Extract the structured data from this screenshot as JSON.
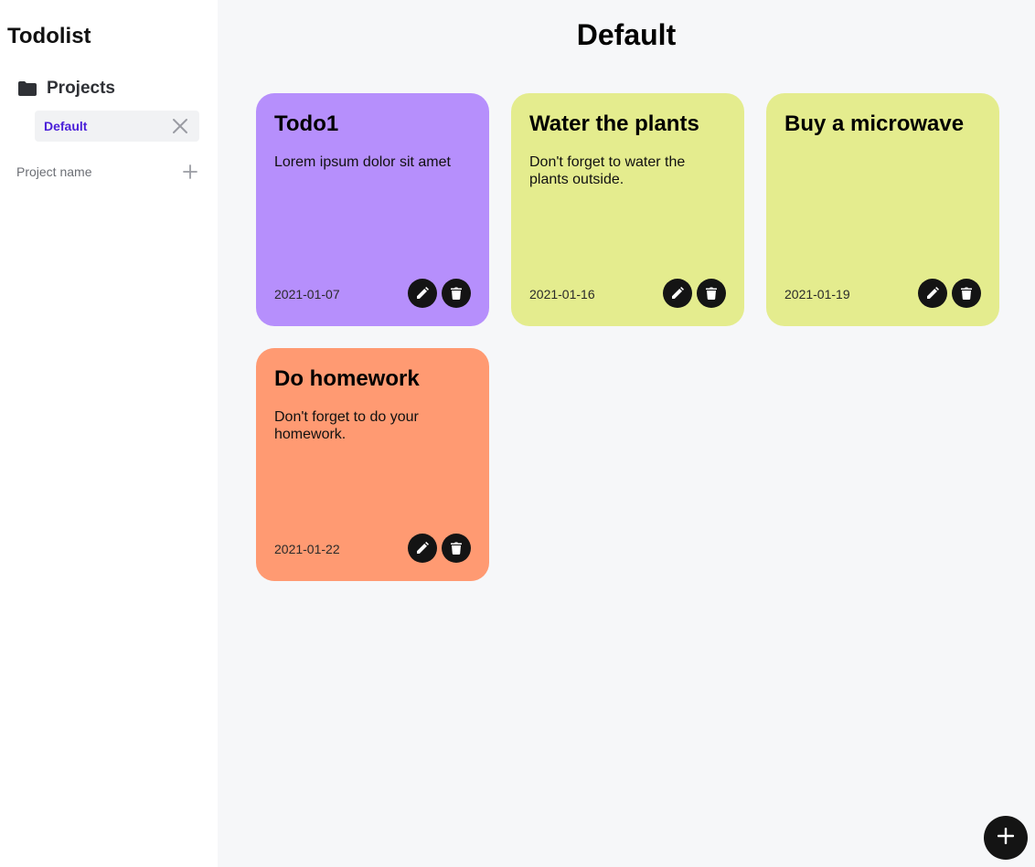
{
  "app": {
    "title": "Todolist"
  },
  "sidebar": {
    "projects_label": "Projects",
    "projects": [
      {
        "label": "Default",
        "selected": true
      }
    ],
    "new_project": {
      "placeholder": "Project name",
      "value": ""
    }
  },
  "main": {
    "title": "Default",
    "todos": [
      {
        "title": "Todo1",
        "description": "Lorem ipsum dolor sit amet",
        "date": "2021-01-07",
        "color": "#b68ffc"
      },
      {
        "title": "Water the plants",
        "description": "Don't forget to water the plants outside.",
        "date": "2021-01-16",
        "color": "#e4ec8e"
      },
      {
        "title": "Buy a microwave",
        "description": "",
        "date": "2021-01-19",
        "color": "#e4ec8e"
      },
      {
        "title": "Do homework",
        "description": "Don't forget to do your homework.",
        "date": "2021-01-22",
        "color": "#ff9a72"
      }
    ]
  },
  "icons": {
    "folder": "folder-icon",
    "close": "close-icon",
    "plus": "plus-icon",
    "edit": "pencil-icon",
    "delete": "trash-icon"
  },
  "colors": {
    "sidebar_bg": "#ffffff",
    "main_bg": "#f6f7f9",
    "accent": "#4a1fd8",
    "button_bg": "#141414"
  }
}
